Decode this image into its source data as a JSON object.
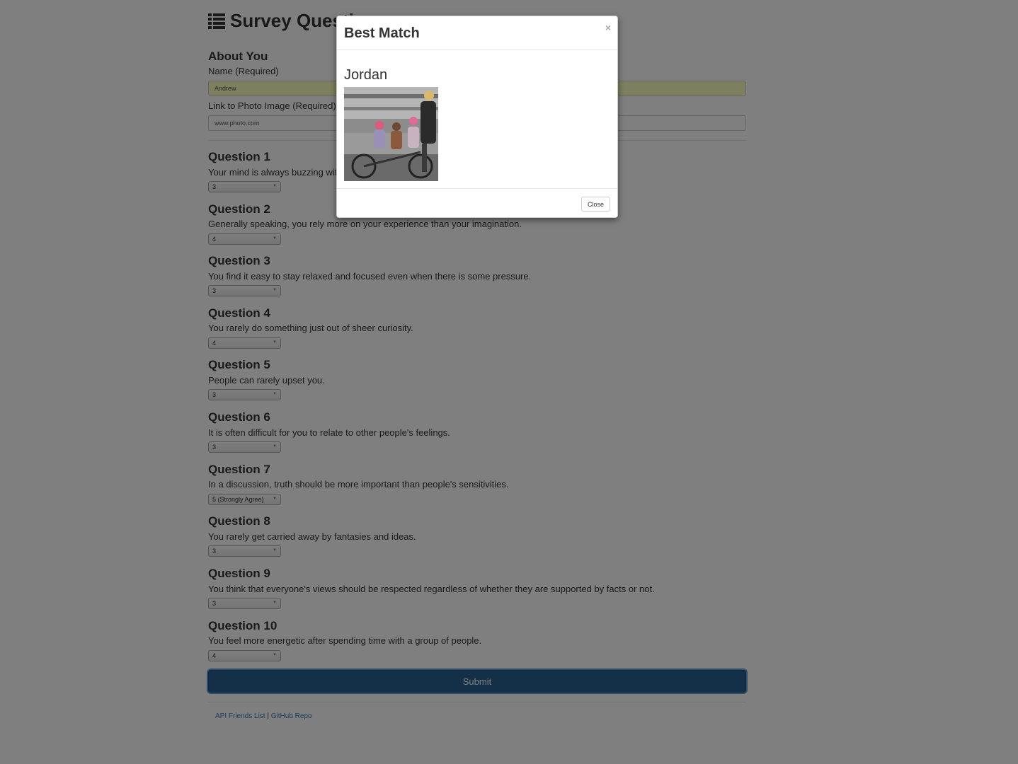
{
  "header": {
    "title": "Survey Questions",
    "icon": "list-icon"
  },
  "about": {
    "heading": "About You",
    "name_label": "Name (Required)",
    "name_value": "Andrew",
    "photo_label": "Link to Photo Image (Required)",
    "photo_value": "www.photo.com"
  },
  "questions": [
    {
      "title": "Question 1",
      "text": "Your mind is always buzzing with unexplored ideas and plans.",
      "selected": "3"
    },
    {
      "title": "Question 2",
      "text": "Generally speaking, you rely more on your experience than your imagination.",
      "selected": "4"
    },
    {
      "title": "Question 3",
      "text": "You find it easy to stay relaxed and focused even when there is some pressure.",
      "selected": "3"
    },
    {
      "title": "Question 4",
      "text": "You rarely do something just out of sheer curiosity.",
      "selected": "4"
    },
    {
      "title": "Question 5",
      "text": "People can rarely upset you.",
      "selected": "3"
    },
    {
      "title": "Question 6",
      "text": "It is often difficult for you to relate to other people's feelings.",
      "selected": "3"
    },
    {
      "title": "Question 7",
      "text": "In a discussion, truth should be more important than people's sensitivities.",
      "selected": "5 (Strongly Agree)"
    },
    {
      "title": "Question 8",
      "text": "You rarely get carried away by fantasies and ideas.",
      "selected": "3"
    },
    {
      "title": "Question 9",
      "text": "You think that everyone's views should be respected regardless of whether they are supported by facts or not.",
      "selected": "3"
    },
    {
      "title": "Question 10",
      "text": "You feel more energetic after spending time with a group of people.",
      "selected": "4"
    }
  ],
  "submit_label": "Submit",
  "footer": {
    "link1": "API Friends List",
    "separator": "|",
    "link2": "GitHub Repo"
  },
  "modal": {
    "title": "Best Match",
    "close_x": "×",
    "match_name": "Jordan",
    "close_button": "Close"
  },
  "colors": {
    "primary": "#286090",
    "link": "#337ab7",
    "autofill": "#faffbd",
    "backdrop": "rgba(0,0,0,0.5)"
  }
}
